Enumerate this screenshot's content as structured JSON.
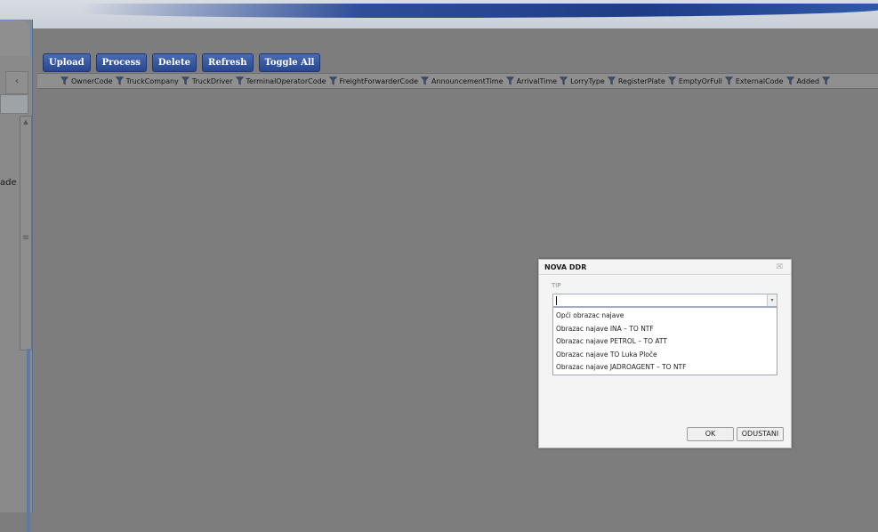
{
  "toolbar": {
    "buttons": [
      "Upload",
      "Process",
      "Delete",
      "Refresh",
      "Toggle All"
    ]
  },
  "grid": {
    "columns": [
      "OwnerCode",
      "TruckCompany",
      "TruckDriver",
      "TerminalOperatorCode",
      "FreightForwarderCode",
      "AnnouncementTime",
      "ArrivalTime",
      "LorryType",
      "RegisterPlate",
      "EmptyOrFull",
      "ExternalCode",
      "Added"
    ]
  },
  "sidebar": {
    "collapse_glyph": "‹",
    "label_fragment": "ade"
  },
  "dialog": {
    "title": "NOVA DDR",
    "close_glyph": "☒",
    "field_label": "TIP",
    "combo_value": "",
    "options": [
      "Opći obrazac najave",
      "Obrazac najave INA – TO NTF",
      "Obrazac najave PETROL – TO ATT",
      "Obrazac najave TO Luka Ploče",
      "Obrazac najave JADROAGENT – TO NTF"
    ],
    "ok_label": "OK",
    "cancel_label": "ODUSTANI"
  },
  "colors": {
    "background": "#7d7d7d",
    "toolbar_button": "#27488f",
    "dialog": "#f4f4f4"
  }
}
